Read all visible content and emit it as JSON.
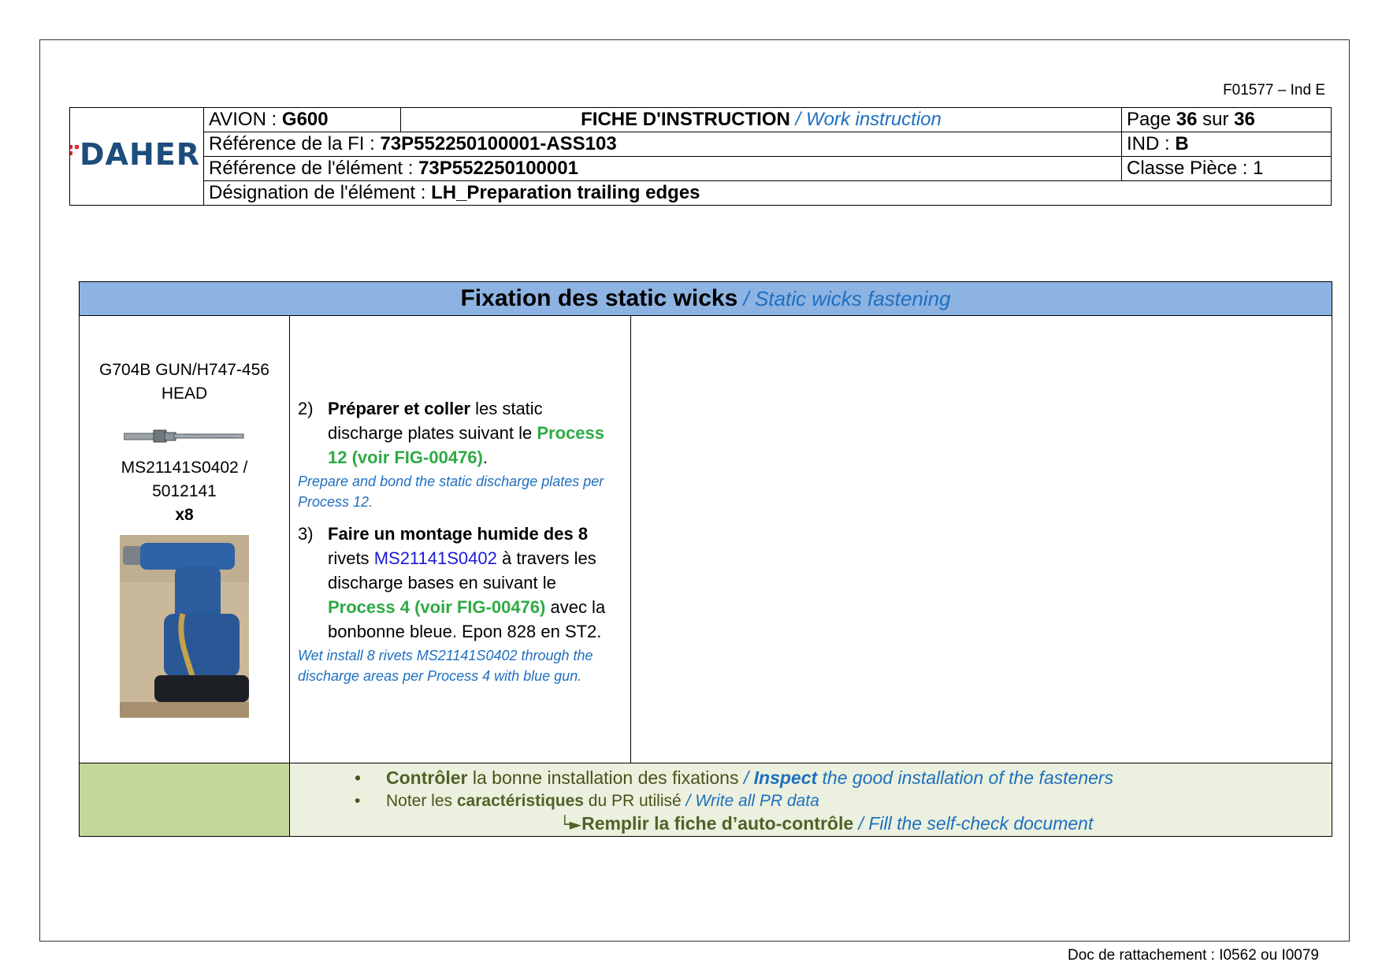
{
  "form_code": "F01577 – Ind E",
  "footer": "Doc de rattachement : I0562 ou I0079",
  "logo_text": "DAHER",
  "header": {
    "avion_label": "AVION : ",
    "avion_value": "G600",
    "doc_title": "FICHE D'INSTRUCTION",
    "doc_title_en": " / Work instruction",
    "page_label": "Page ",
    "page_current": "36",
    "page_sep": " sur ",
    "page_total": "36",
    "ref_fi_label": "Référence de la FI : ",
    "ref_fi_value": "73P552250100001-ASS103",
    "ind_label": "IND : ",
    "ind_value": "B",
    "ref_elem_label": "Référence de l'élément : ",
    "ref_elem_value": "73P552250100001",
    "classe_label": "Classe Pièce : 1",
    "design_label": "Désignation de l'élément : ",
    "design_value": "LH_Preparation trailing edges"
  },
  "section": {
    "title_fr": "Fixation des static wicks",
    "title_en": " / Static wicks fastening"
  },
  "tools": {
    "tool_line1": "G704B GUN/H747-456",
    "tool_line2": "HEAD",
    "part_line1": "MS21141S0402 /",
    "part_line2": "5012141",
    "qty": "x8"
  },
  "steps": [
    {
      "num": "2)",
      "bold": "Préparer et coller",
      "text1": " les static discharge plates suivant le ",
      "green": "Process 12 (voir FIG-00476)",
      "text2": ".",
      "en": "Prepare and bond the static discharge plates per Process 12."
    },
    {
      "num": "3)",
      "bold": "Faire un montage humide des 8",
      "text1": " rivets ",
      "link": "MS21141S0402",
      "text2": " à travers les discharge bases en suivant le ",
      "green": "Process 4 (voir FIG-00476)",
      "text3": " avec la bonbonne bleue. Epon 828 en ST2.",
      "en": "Wet install 8 rivets MS21141S0402 through the discharge areas per Process 4 with blue gun."
    }
  ],
  "checks": {
    "c1_bold": "Contrôler",
    "c1_text": " la bonne installation des fixations ",
    "c1_sep": "/ ",
    "c1_en_bold": "Inspect",
    "c1_en": " the good installation of the fasteners",
    "c2_text": "Noter les ",
    "c2_bold": "caractéristiques",
    "c2_text2": " du PR utilisé ",
    "c2_en": "/ Write all PR data",
    "c3_arrow": "└►",
    "c3_bold": "Remplir la fiche d’auto-contrôle",
    "c3_en": " / Fill the self-check document"
  },
  "colors": {
    "title_bg": "#8db3e2",
    "check_left_bg": "#c4d79b",
    "check_right_bg": "#ebf1de",
    "green_text": "#2eaa44",
    "blue_italic": "#1f6fc0",
    "logo_blue": "#1d4d7c",
    "logo_red": "#e3262e"
  }
}
